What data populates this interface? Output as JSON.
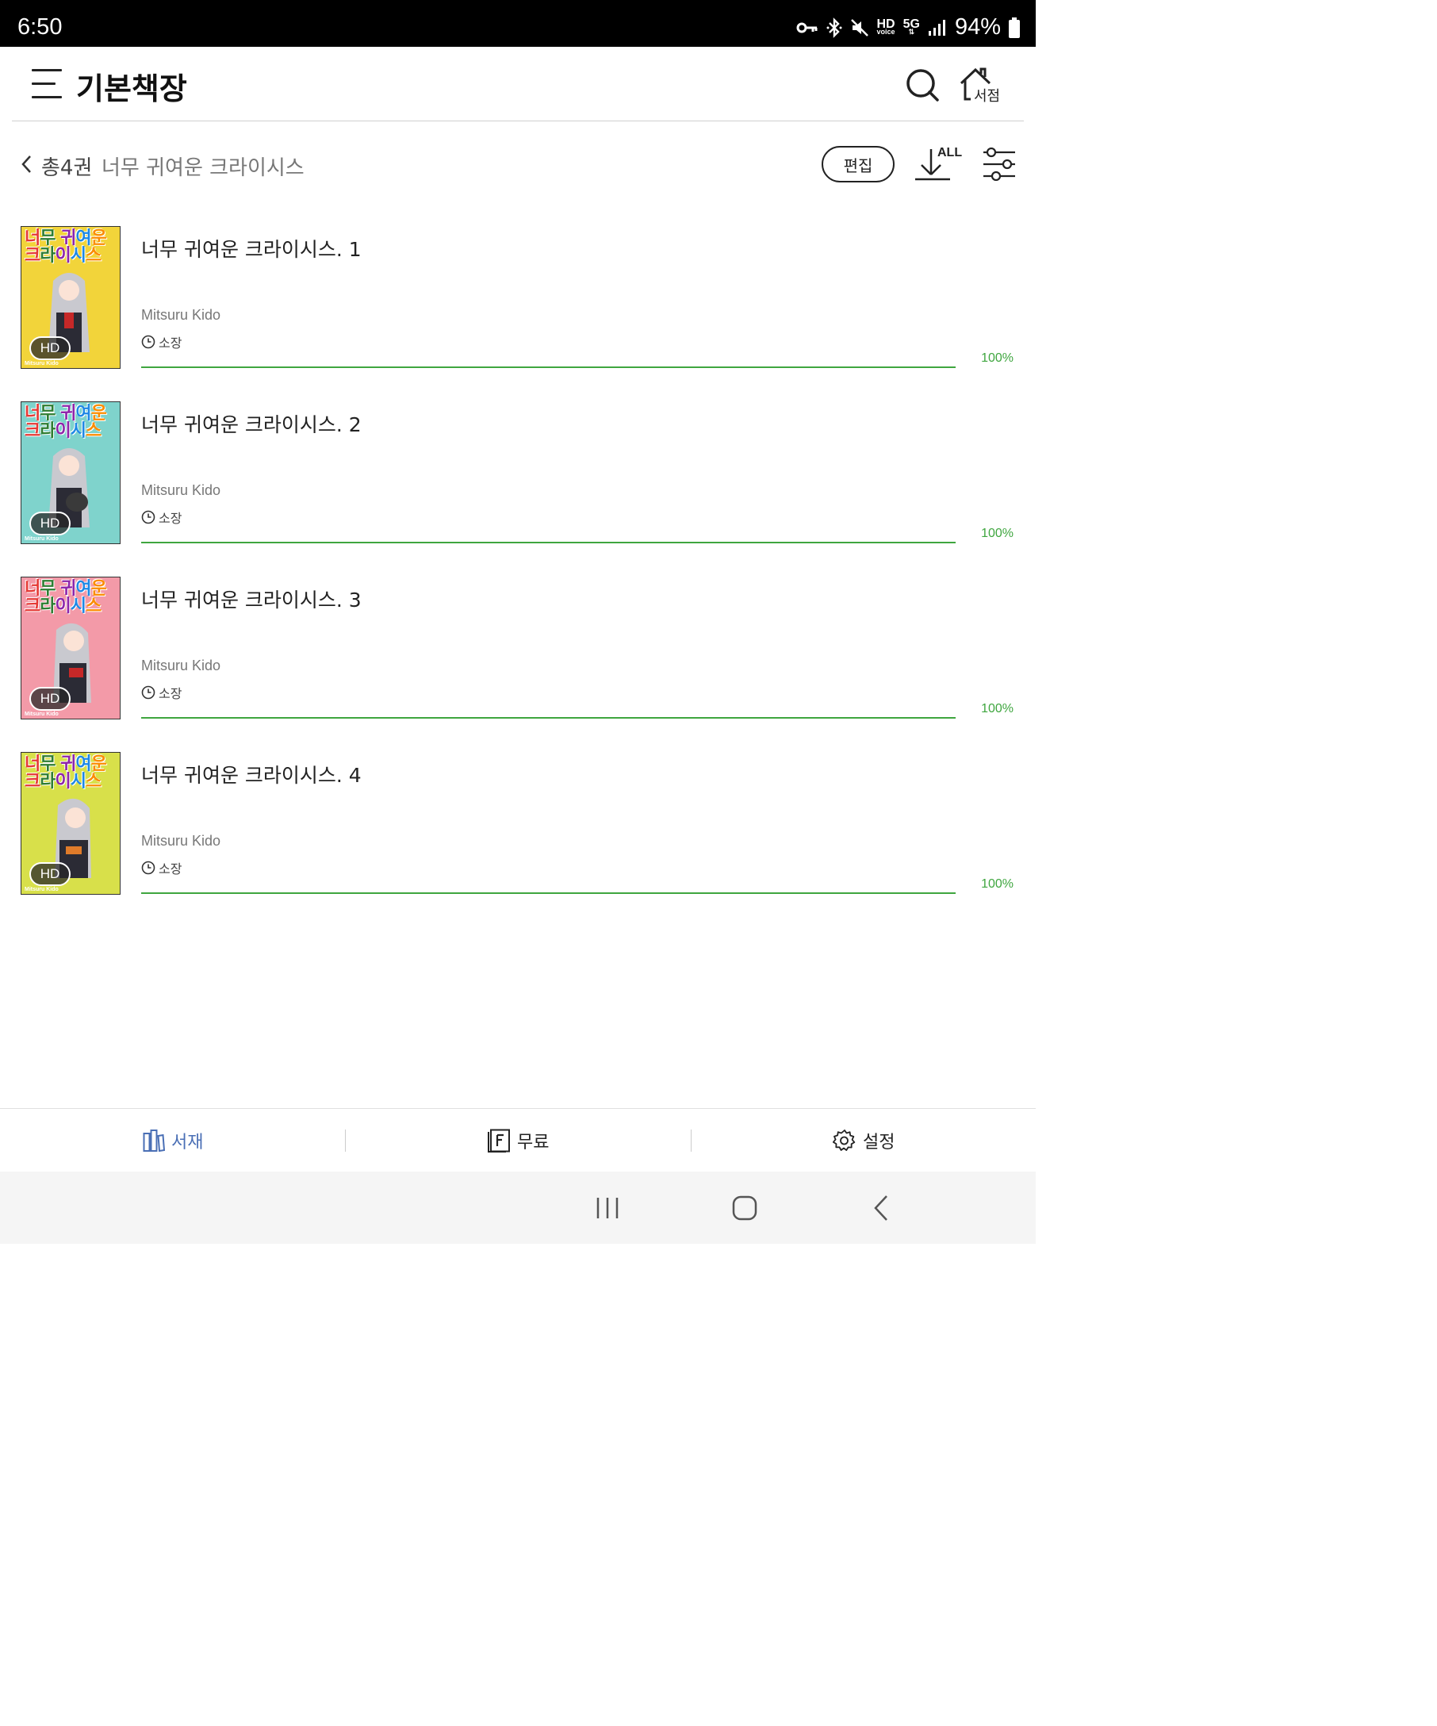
{
  "status_bar": {
    "time": "6:50",
    "hd_top": "HD",
    "hd_bottom": "voice",
    "network": "5G",
    "battery": "94%"
  },
  "header": {
    "title": "기본책장",
    "store_label": "서점"
  },
  "subheader": {
    "count": "총4권",
    "series": "너무 귀여운 크라이시스",
    "edit_label": "편집",
    "download_all_label": "ALL"
  },
  "books": [
    {
      "title": "너무 귀여운 크라이시스. 1",
      "author": "Mitsuru Kido",
      "status": "소장",
      "progress": "100%",
      "progress_value": 1.0,
      "cover_title": "너무 귀여운 크라이시스",
      "cover_badge": "HD",
      "cover_author": "Mitsuru Kido",
      "cover_color": "#f2d43a"
    },
    {
      "title": "너무 귀여운 크라이시스. 2",
      "author": "Mitsuru Kido",
      "status": "소장",
      "progress": "100%",
      "progress_value": 1.0,
      "cover_title": "너무 귀여운 크라이시스",
      "cover_badge": "HD",
      "cover_author": "Mitsuru Kido",
      "cover_color": "#7fd3cc"
    },
    {
      "title": "너무 귀여운 크라이시스. 3",
      "author": "Mitsuru Kido",
      "status": "소장",
      "progress": "100%",
      "progress_value": 1.0,
      "cover_title": "너무 귀여운 크라이시스",
      "cover_badge": "HD",
      "cover_author": "Mitsuru Kido",
      "cover_color": "#f39aa8"
    },
    {
      "title": "너무 귀여운 크라이시스. 4",
      "author": "Mitsuru Kido",
      "status": "소장",
      "progress": "100%",
      "progress_value": 1.0,
      "cover_title": "너무 귀여운 크라이시스",
      "cover_badge": "HD",
      "cover_author": "Mitsuru Kido",
      "cover_color": "#d8e04a"
    }
  ],
  "bottom_nav": {
    "library": "서재",
    "free": "무료",
    "settings": "설정"
  },
  "colors": {
    "accent_green": "#3fa63f",
    "nav_active": "#4a6fb5"
  }
}
